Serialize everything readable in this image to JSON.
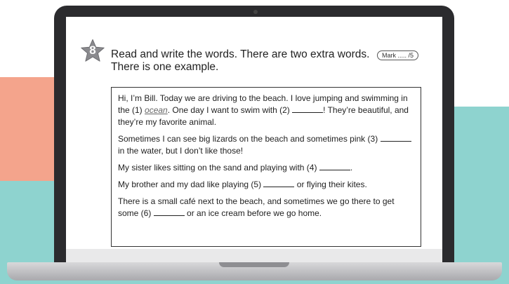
{
  "exercise": {
    "number": "8",
    "instruction": "Read and write the words. There are two extra words. There is one example.",
    "mark": "Mark ..... /5"
  },
  "text": {
    "p1": {
      "a": "Hi, I’m Bill. Today we are driving to the beach. I love jumping and swimming in the (1) ",
      "example": "ocean",
      "b": ". One day I want to swim with (2) ",
      "c": "! They’re beautiful, and they’re my favorite animal."
    },
    "p2": {
      "a": "Sometimes I can see big lizards on the beach and sometimes pink (3) ",
      "b": " in the water, but I don’t like those!"
    },
    "p3": {
      "a": "My sister likes sitting on the sand and playing with (4) ",
      "b": "."
    },
    "p4": {
      "a": "My brother and my dad like playing (5) ",
      "b": " or flying their kites."
    },
    "p5": {
      "a": "There is a small café next to the beach, and sometimes we go there to get some (6) ",
      "b": " or an ice cream before we go home."
    }
  },
  "colors": {
    "star": "#8a8a8e",
    "salmon": "#f4a48c",
    "teal": "#8ed3cf",
    "laptop": "#2b2b2e"
  }
}
